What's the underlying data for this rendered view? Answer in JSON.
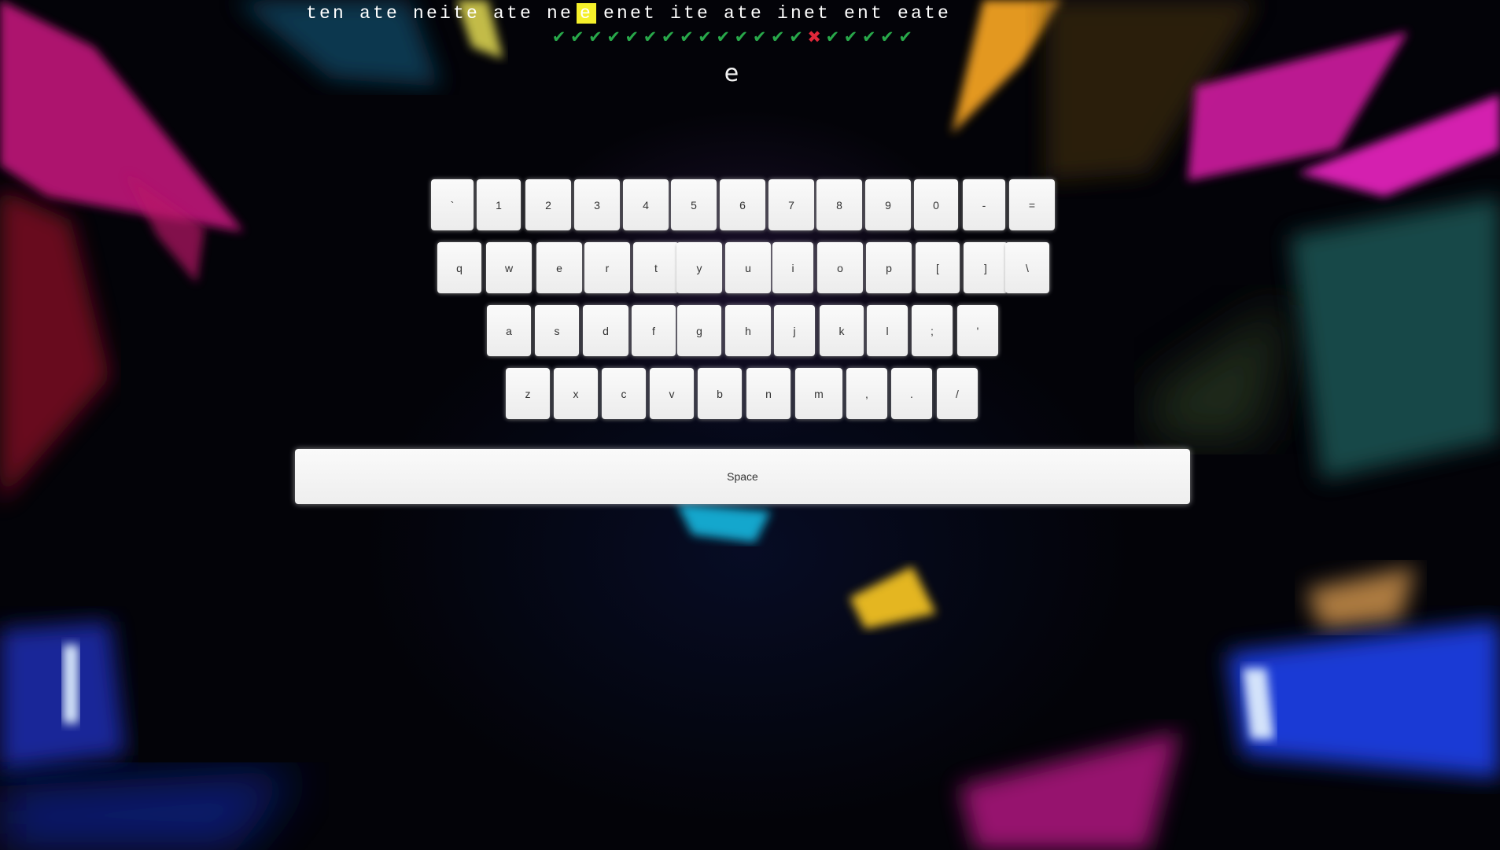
{
  "typing": {
    "typed_text": "ten ate neite ate ne",
    "current_char": "e",
    "remaining_text": "enet ite ate inet ent eate",
    "results": [
      "ok",
      "ok",
      "ok",
      "ok",
      "ok",
      "ok",
      "ok",
      "ok",
      "ok",
      "ok",
      "ok",
      "ok",
      "ok",
      "ok",
      "bad",
      "ok",
      "ok",
      "ok",
      "ok",
      "ok"
    ],
    "prompt_char": "e",
    "icons": {
      "ok": "check-icon",
      "bad": "cross-icon"
    },
    "colors": {
      "ok": "#28a84a",
      "bad": "#e0283a",
      "highlight": "#f5f02a"
    }
  },
  "keyboard": {
    "rows": [
      [
        "`",
        "1",
        "2",
        "3",
        "4",
        "5",
        "6",
        "7",
        "8",
        "9",
        "0",
        "-",
        "="
      ],
      [
        "q",
        "w",
        "e",
        "r",
        "t",
        "y",
        "u",
        "i",
        "o",
        "p",
        "[",
        "]",
        "\\"
      ],
      [
        "a",
        "s",
        "d",
        "f",
        "g",
        "h",
        "j",
        "k",
        "l",
        ";",
        "'"
      ],
      [
        "z",
        "x",
        "c",
        "v",
        "b",
        "n",
        "m",
        ",",
        ".",
        "/"
      ]
    ],
    "space_label": "Space"
  }
}
